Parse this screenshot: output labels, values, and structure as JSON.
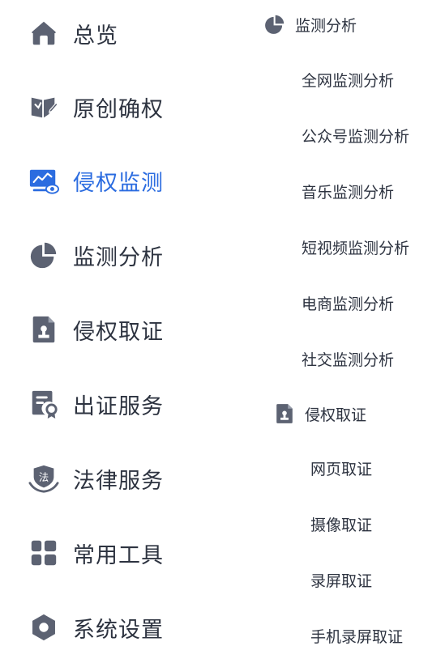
{
  "main_nav": {
    "items": [
      {
        "label": "总览",
        "icon": "home-icon"
      },
      {
        "label": "原创确权",
        "icon": "book-pen-icon"
      },
      {
        "label": "侵权监测",
        "icon": "monitor-eye-icon"
      },
      {
        "label": "监测分析",
        "icon": "pie-chart-icon"
      },
      {
        "label": "侵权取证",
        "icon": "document-person-icon"
      },
      {
        "label": "出证服务",
        "icon": "certificate-icon"
      },
      {
        "label": "法律服务",
        "icon": "law-shield-icon"
      },
      {
        "label": "常用工具",
        "icon": "grid-tools-icon"
      },
      {
        "label": "系统设置",
        "icon": "gear-icon"
      }
    ],
    "active_index": 2
  },
  "sub_nav": {
    "monitor_analysis": {
      "title": "监测分析",
      "icon": "pie-chart-icon",
      "items": [
        "全网监测分析",
        "公众号监测分析",
        "音乐监测分析",
        "短视频监测分析",
        "电商监测分析",
        "社交监测分析"
      ]
    },
    "evidence": {
      "title": "侵权取证",
      "icon": "document-person-icon",
      "items": [
        "网页取证",
        "摄像取证",
        "录屏取证",
        "手机录屏取证"
      ]
    }
  },
  "colors": {
    "text": "#2d3340",
    "icon": "#5c6272",
    "accent": "#2b6ce0"
  }
}
